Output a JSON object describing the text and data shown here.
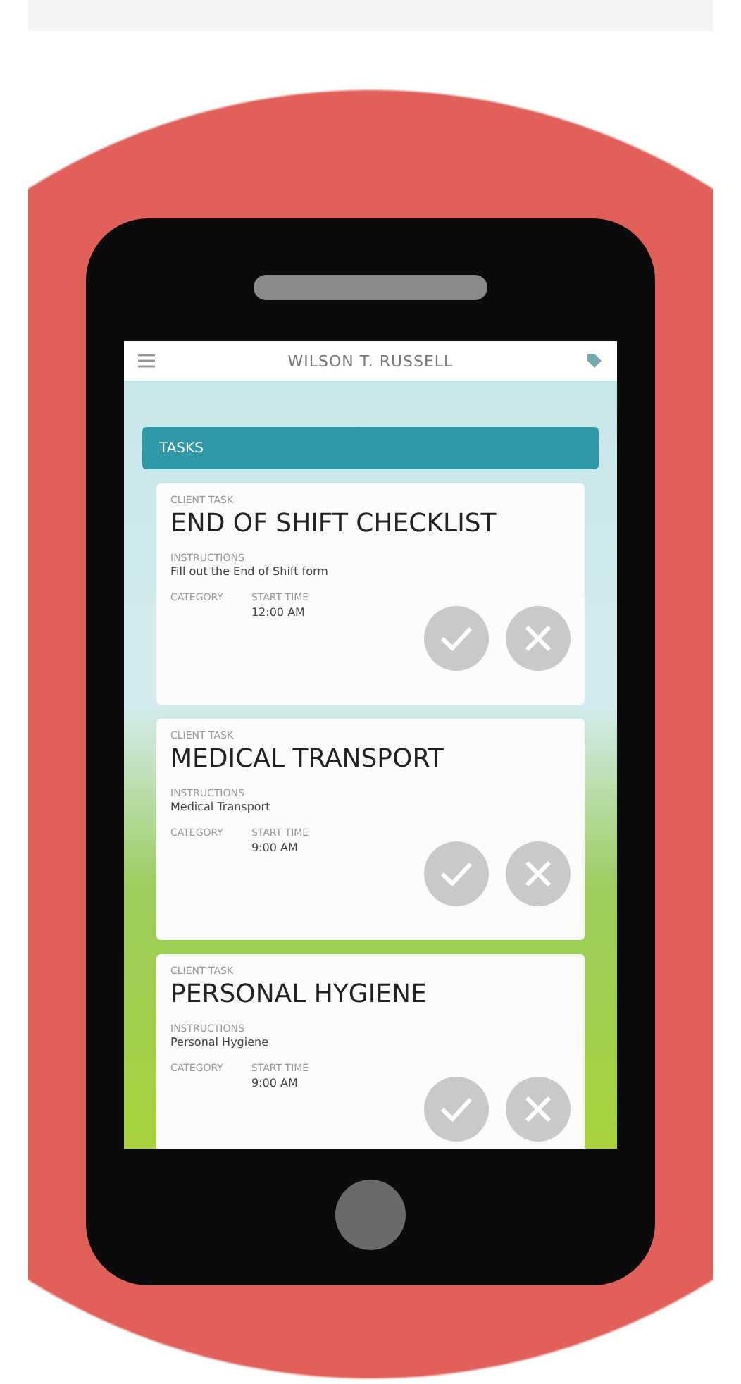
{
  "header": {
    "title": "WILSON T. RUSSELL"
  },
  "tasks_panel": {
    "title": "TASKS"
  },
  "tasks": [
    {
      "label": "CLIENT TASK",
      "name": "END OF SHIFT CHECKLIST",
      "instructions_label": "INSTRUCTIONS",
      "instructions": "Fill out the End of Shift form",
      "category_label": "CATEGORY",
      "start_time_label": "START TIME",
      "start_time": "12:00 AM"
    },
    {
      "label": "CLIENT TASK",
      "name": "MEDICAL TRANSPORT",
      "instructions_label": "INSTRUCTIONS",
      "instructions": "Medical Transport",
      "category_label": "CATEGORY",
      "start_time_label": "START TIME",
      "start_time": "9:00 AM"
    },
    {
      "label": "CLIENT TASK",
      "name": "PERSONAL HYGIENE",
      "instructions_label": "INSTRUCTIONS",
      "instructions": "Personal Hygiene",
      "category_label": "CATEGORY",
      "start_time_label": "START TIME",
      "start_time": "9:00 AM"
    }
  ]
}
